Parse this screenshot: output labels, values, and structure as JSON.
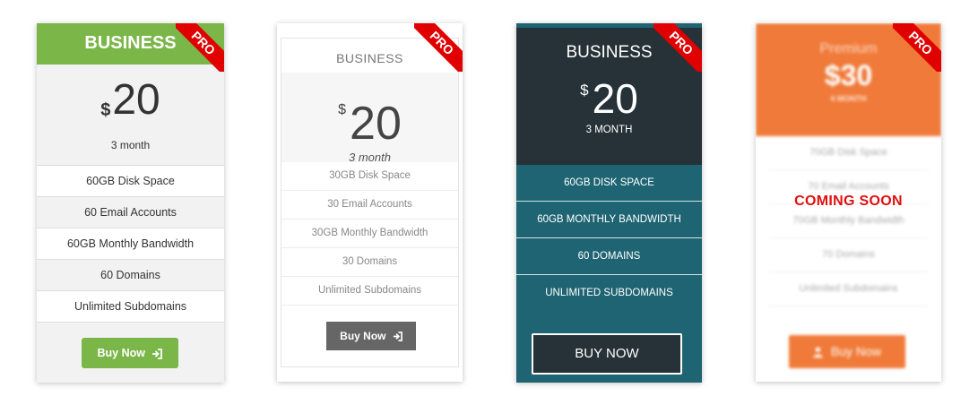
{
  "ribbon": "PRO",
  "card1": {
    "title": "BUSINESS",
    "currency": "$",
    "price": "20",
    "period": "3 month",
    "features": [
      "60GB Disk Space",
      "60 Email Accounts",
      "60GB Monthly Bandwidth",
      "60 Domains",
      "Unlimited Subdomains"
    ],
    "button": "Buy Now",
    "button_icon": "sign-in-icon",
    "accent": "#7ab648"
  },
  "card2": {
    "title": "BUSINESS",
    "currency": "$",
    "price": "20",
    "period": "3 month",
    "features": [
      "30GB Disk Space",
      "30 Email Accounts",
      "30GB Monthly Bandwidth",
      "30 Domains",
      "Unlimited Subdomains"
    ],
    "button": "Buy Now",
    "button_icon": "sign-in-icon",
    "accent": "#666666"
  },
  "card3": {
    "title": "BUSINESS",
    "currency": "$",
    "price": "20",
    "period": "3 MONTH",
    "features": [
      "60GB DISK SPACE",
      "60GB MONTHLY BANDWIDTH",
      "60 DOMAINS",
      "UNLIMITED SUBDOMAINS"
    ],
    "button": "BUY NOW",
    "accent": "#1f6472",
    "header_color": "#263238"
  },
  "card4": {
    "title": "Premium",
    "price": "$30",
    "period": "4 MONTH",
    "features": [
      "70GB Disk Space",
      "70 Email Accounts",
      "70GB Monthly Bandwidth",
      "70 Domains",
      "Unlimited Subdomains"
    ],
    "button": "Buy Now",
    "button_icon": "user-icon",
    "overlay": "COMING SOON",
    "accent": "#f07a39"
  }
}
